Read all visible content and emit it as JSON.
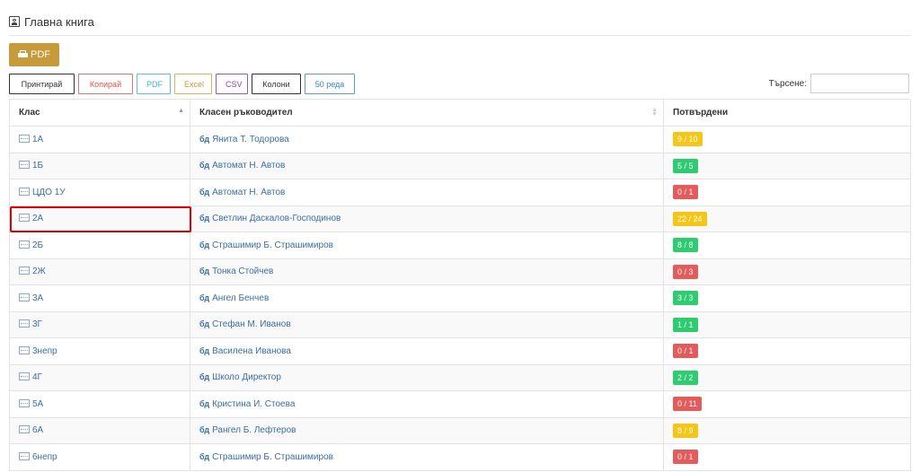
{
  "page": {
    "title": "Главна книга",
    "title_icon": "user-book-icon"
  },
  "toolbar": {
    "pdf_label": "PDF",
    "pdf_icon": "printer-icon"
  },
  "export_buttons": {
    "print": "Принтирай",
    "copy": "Копирай",
    "pdf": "PDF",
    "excel": "Excel",
    "csv": "CSV",
    "columns": "Колони",
    "rows": "50 реда"
  },
  "search": {
    "label": "Търсене:",
    "value": ""
  },
  "table": {
    "headers": [
      "Клас",
      "Класен ръководител",
      "Потвърдени"
    ],
    "rows": [
      {
        "class": "1А",
        "teacher": "Янита Т. Тодорова",
        "confirmed": "9 / 10",
        "status": "yellow"
      },
      {
        "class": "1Б",
        "teacher": "Автомат Н. Автов",
        "confirmed": "5 / 5",
        "status": "green"
      },
      {
        "class": "ЦДО 1У",
        "teacher": "Автомат Н. Автов",
        "confirmed": "0 / 1",
        "status": "red"
      },
      {
        "class": "2А",
        "teacher": "Светлин Даскалов-Господинов",
        "confirmed": "22 / 24",
        "status": "yellow"
      },
      {
        "class": "2Б",
        "teacher": "Страшимир Б. Страшимиров",
        "confirmed": "8 / 8",
        "status": "green"
      },
      {
        "class": "2Ж",
        "teacher": "Тонка Стойчев",
        "confirmed": "0 / 3",
        "status": "red"
      },
      {
        "class": "3А",
        "teacher": "Ангел Бенчев",
        "confirmed": "3 / 3",
        "status": "green"
      },
      {
        "class": "3Г",
        "teacher": "Стефан М. Иванов",
        "confirmed": "1 / 1",
        "status": "green"
      },
      {
        "class": "3непр",
        "teacher": "Василена Иванова",
        "confirmed": "0 / 1",
        "status": "red"
      },
      {
        "class": "4Г",
        "teacher": "Школо Директор",
        "confirmed": "2 / 2",
        "status": "green"
      },
      {
        "class": "5А",
        "teacher": "Кристина И. Стоева",
        "confirmed": "0 / 11",
        "status": "red"
      },
      {
        "class": "6А",
        "teacher": "Рангел Б. Лефтеров",
        "confirmed": "8 / 9",
        "status": "yellow"
      },
      {
        "class": "6непр",
        "teacher": "Страшимир Б. Страшимиров",
        "confirmed": "0 / 1",
        "status": "red"
      }
    ]
  },
  "colors": {
    "pdf_button": "#c79a3b",
    "badge_yellow": "#f5c518",
    "badge_green": "#2ecc71",
    "badge_red": "#e55b5b",
    "link": "#3a6ea5",
    "highlight": "#e00000"
  }
}
